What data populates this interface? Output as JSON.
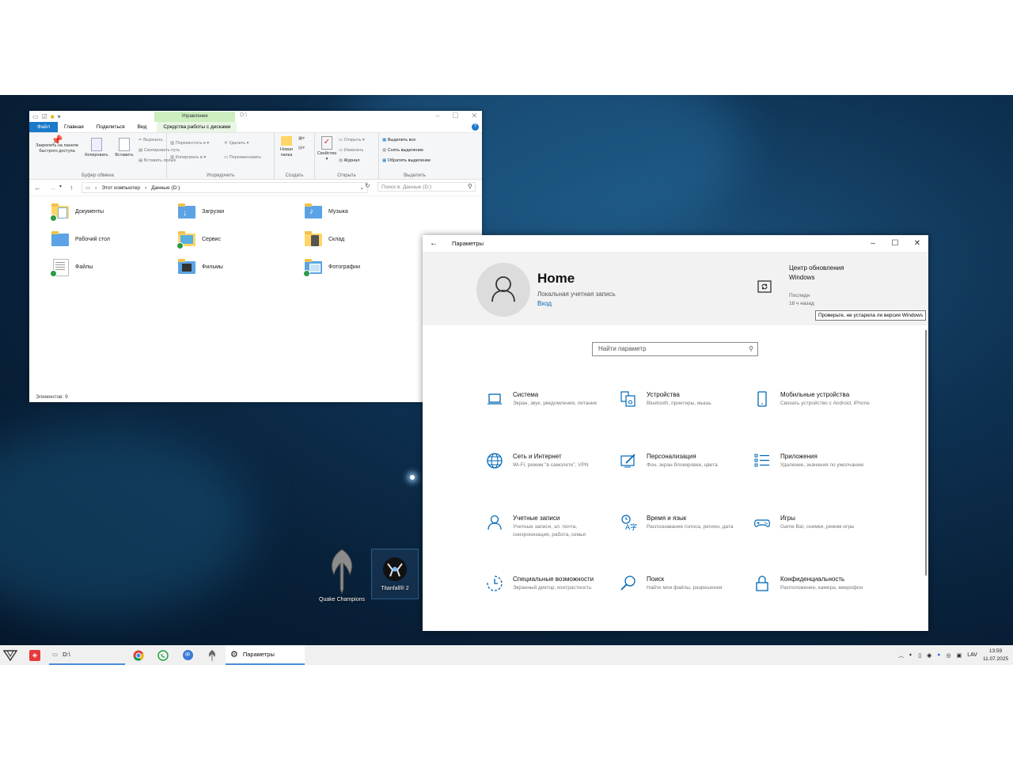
{
  "explorer": {
    "title_path": "D:\\",
    "manage_tab": "Управление",
    "tabs": [
      "Файл",
      "Главная",
      "Поделиться",
      "Вид"
    ],
    "drive_tools_tab": "Средства работы с дисками",
    "ribbon": {
      "pin": "Закрепить на панели быстрого доступа",
      "copy": "Копировать",
      "paste": "Вставить",
      "cut": "Вырезать",
      "copy_path": "Скопировать путь",
      "paste_shortcut": "Вставить ярлык",
      "clipboard_group": "Буфер обмена",
      "move_to": "Переместить в",
      "copy_to": "Копировать в",
      "delete": "Удалить",
      "rename": "Переименовать",
      "organize_group": "Упорядочить",
      "new_folder": "Новая папка",
      "create_group": "Создать",
      "properties": "Свойства",
      "open": "Открыть",
      "edit": "Изменить",
      "history": "Журнал",
      "open_group": "Открыть",
      "select_all": "Выделить все",
      "select_none": "Снять выделение",
      "invert_selection": "Обратить выделение",
      "select_group": "Выделить"
    },
    "breadcrumb": [
      "Этот компьютер",
      "Данные (D:)"
    ],
    "search_placeholder": "Поиск в: Данные (D:)",
    "folders": [
      {
        "name": "Документы"
      },
      {
        "name": "Загрузки"
      },
      {
        "name": "Музыка"
      },
      {
        "name": "Рабочий стол"
      },
      {
        "name": "Сервис"
      },
      {
        "name": "Склад"
      },
      {
        "name": "Файлы"
      },
      {
        "name": "Фильмы"
      },
      {
        "name": "Фотографии"
      }
    ],
    "status": "Элементов: 9"
  },
  "settings": {
    "window_title": "Параметры",
    "user_name": "Home",
    "account_type": "Локальная учетная запись",
    "sign_in": "Вход",
    "update_title": "Центр обновления Windows",
    "update_sub1": "Последн",
    "update_sub2": "18 ч назад",
    "tooltip": "Проверьте, не устарела ли версия Windows",
    "search_placeholder": "Найти параметр",
    "categories": [
      {
        "title": "Система",
        "desc": "Экран, звук, уведомления, питание",
        "icon": "laptop-icon"
      },
      {
        "title": "Устройства",
        "desc": "Bluetooth, принтеры, мышь",
        "icon": "devices-icon"
      },
      {
        "title": "Мобильные устройства",
        "desc": "Связать устройство с Android, iPhone",
        "icon": "phone-icon"
      },
      {
        "title": "Сеть и Интернет",
        "desc": "Wi-Fi, режим \"в самолете\", VPN",
        "icon": "globe-icon"
      },
      {
        "title": "Персонализация",
        "desc": "Фон, экран блокировки, цвета",
        "icon": "personalization-icon"
      },
      {
        "title": "Приложения",
        "desc": "Удаление, значения по умолчанию",
        "icon": "apps-icon"
      },
      {
        "title": "Учетные записи",
        "desc": "Учетные записи, эл. почта, синхронизация, работа, семья",
        "icon": "person-icon"
      },
      {
        "title": "Время и язык",
        "desc": "Распознавание голоса, регион, дата",
        "icon": "time-language-icon"
      },
      {
        "title": "Игры",
        "desc": "Game Bar, снимки, режим игры",
        "icon": "gamepad-icon"
      },
      {
        "title": "Специальные возможности",
        "desc": "Экранный диктор, контрастность",
        "icon": "accessibility-icon"
      },
      {
        "title": "Поиск",
        "desc": "Найти мои файлы, разрешения",
        "icon": "search-icon"
      },
      {
        "title": "Конфиденциальность",
        "desc": "Расположение, камера, микрофон",
        "icon": "lock-icon"
      }
    ]
  },
  "desktop_icons": [
    {
      "label": "Quake Champions"
    },
    {
      "label": "Titanfall® 2"
    }
  ],
  "taskbar": {
    "explorer_label": "D:\\",
    "settings_label": "Параметры",
    "lang": "LAV",
    "time": "13:59",
    "date": "11.07.2025"
  },
  "colors": {
    "accent": "#0066b4",
    "file_tab": "#1979ca",
    "manage_tab": "#cdeebf"
  }
}
